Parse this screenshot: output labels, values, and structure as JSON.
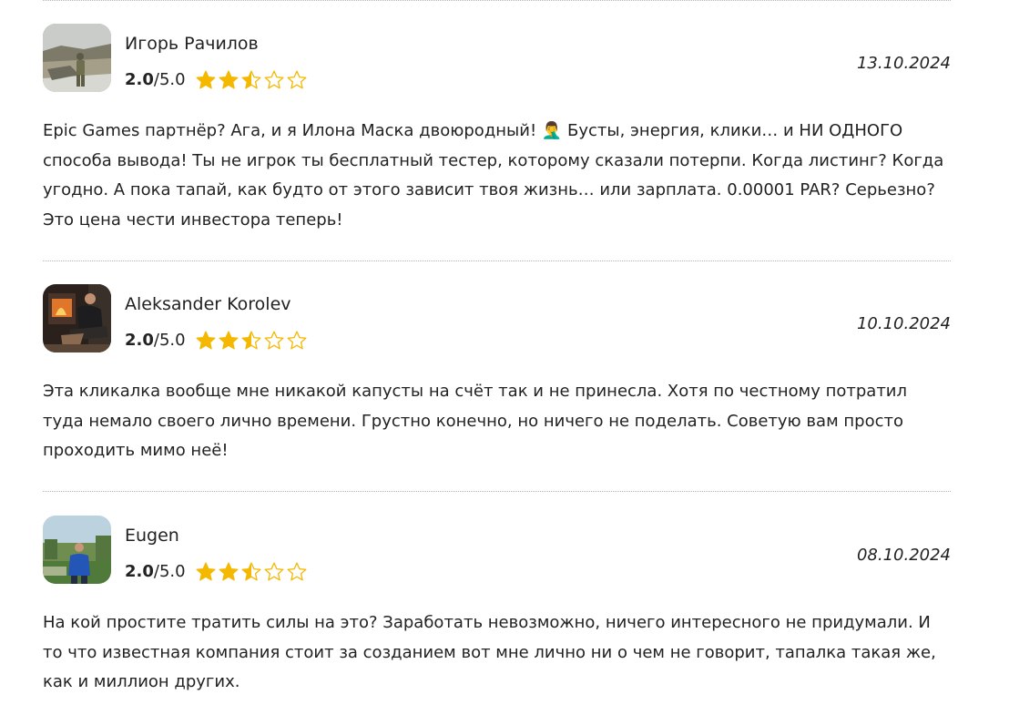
{
  "reviews": [
    {
      "name": "Игорь Рачилов",
      "score": "2.0",
      "max": "/5.0",
      "rating": 2.5,
      "date": "13.10.2024",
      "avatar_icon": "soldier-photo-avatar",
      "text": "Epic Games партнёр? Ага, и я Илона Маска двоюродный! 🤦‍♂️ Бусты, энергия, клики… и НИ ОДНОГО способа вывода! Ты не игрок ты бесплатный тестер, которому сказали потерпи. Когда листинг? Когда угодно. А пока тапай, как будто от этого зависит твоя жизнь… или зарплата. 0.00001 PAR? Серьезно? Это цена чести инвестора теперь!"
    },
    {
      "name": "Aleksander Korolev",
      "score": "2.0",
      "max": "/5.0",
      "rating": 2.5,
      "date": "10.10.2024",
      "avatar_icon": "man-by-fireplace-avatar",
      "text": "Эта кликалка вообще мне никакой капусты на счёт так и не принесла. Хотя по честному потратил туда немало своего лично времени. Грустно конечно, но ничего не поделать. Советую вам просто проходить мимо неё!"
    },
    {
      "name": "Eugen",
      "score": "2.0",
      "max": "/5.0",
      "rating": 2.5,
      "date": "08.10.2024",
      "avatar_icon": "man-outdoors-avatar",
      "text": "На кой простите тратить силы на это? Заработать невозможно, ничего интересного не придумали. И то что известная компания стоит за созданием вот мне лично ни о чем не говорит, тапалка такая же, как и миллион других."
    }
  ],
  "colors": {
    "star": "#f5b800",
    "divider": "#b5b5b5",
    "text": "#222222"
  }
}
